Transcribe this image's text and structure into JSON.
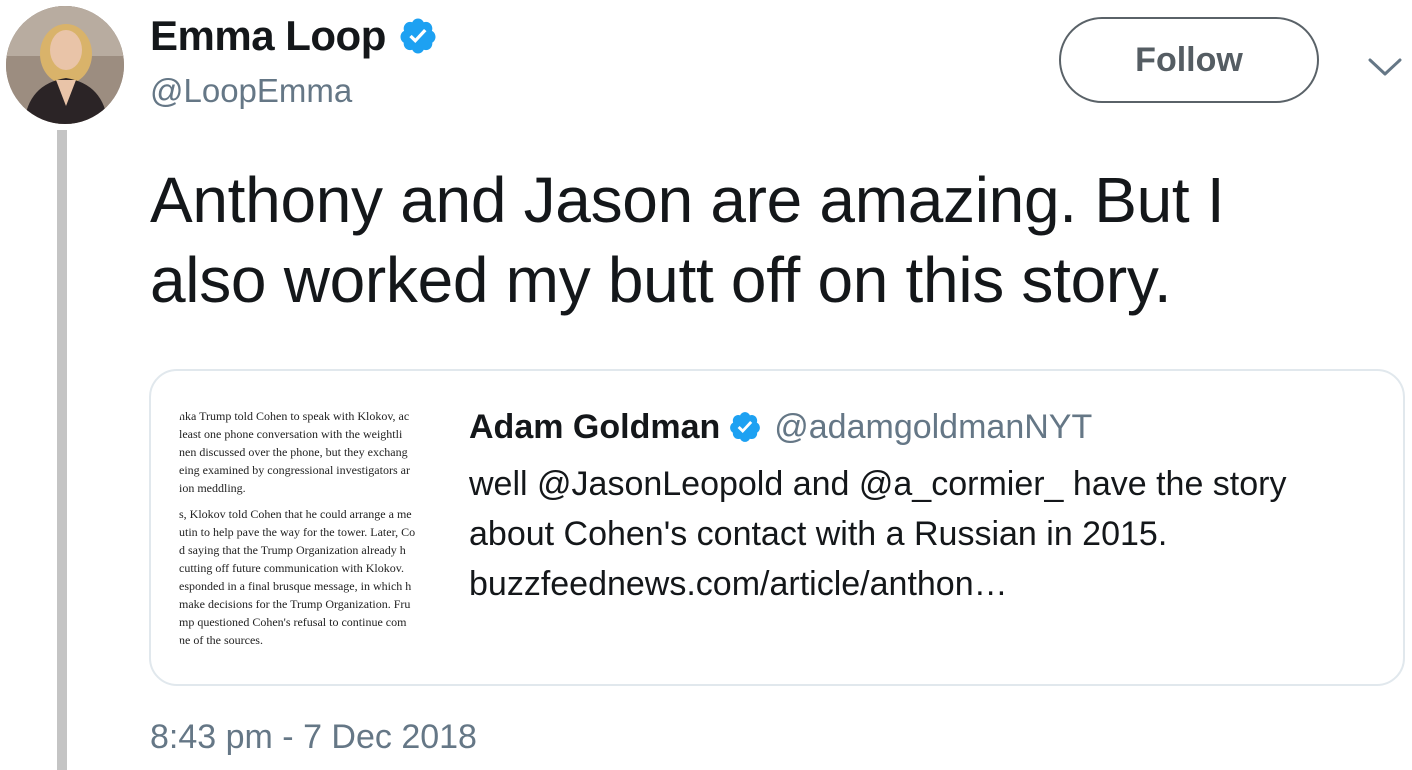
{
  "tweet": {
    "author": {
      "display_name": "Emma Loop",
      "handle": "@LoopEmma",
      "verified": true
    },
    "follow_label": "Follow",
    "text_lines": [
      "Anthony and Jason are amazing. But I",
      "also worked my butt off on this story."
    ],
    "timestamp": "8:43 pm - 7 Dec 2018"
  },
  "quoted_tweet": {
    "display_name": "Adam Goldman",
    "handle": "@adamgoldmanNYT",
    "verified": true,
    "body_lines": [
      "well @JasonLeopold and @a_cormier_ have the story",
      "about Cohen's contact with a Russian in 2015.",
      "buzzfeednews.com/article/anthon…"
    ],
    "thumbnail_lines_p1": [
      "nka Trump told Cohen to speak with Klokov, ac",
      "least one phone conversation with the weightli",
      "nen discussed over the phone, but they exchang",
      "eing examined by congressional investigators ar",
      "ion meddling."
    ],
    "thumbnail_lines_p2": [
      "s, Klokov told Cohen that he could arrange a me",
      "utin to help pave the way for the tower. Later, Co",
      "d saying that the Trump Organization already h",
      "cutting off future communication with Klokov.",
      "esponded in a final brusque message, in which h",
      "make decisions for the Trump Organization. Fru",
      "mp questioned Cohen's refusal to continue com",
      "ne of the sources."
    ]
  },
  "colors": {
    "text_primary": "#14171a",
    "text_secondary": "#657786",
    "verified_blue": "#1da1f2",
    "card_border": "#e1e8ed",
    "thread_line": "#c4c4c4"
  }
}
